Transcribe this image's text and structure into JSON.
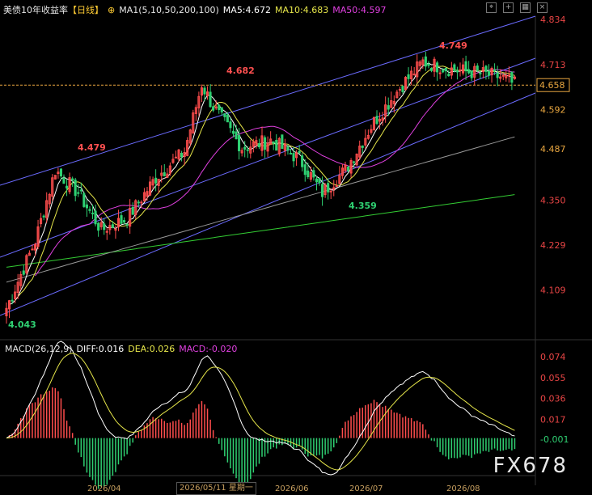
{
  "header": {
    "title": "美债10年收益率",
    "period": "【日线】",
    "ma_label": "MA1(5,10,50,200,100)",
    "ma5": "MA5:4.672",
    "ma10": "MA10:4.683",
    "ma50": "MA50:4.597",
    "colors": {
      "title": "#e6e6e6",
      "period": "#ffcc33",
      "ma5": "#ffffff",
      "ma10": "#e6e64a",
      "ma50": "#e040e0"
    }
  },
  "toolbar": {
    "icons": [
      "crosshair-icon",
      "add-icon",
      "grid-icon",
      "close-icon"
    ]
  },
  "macd_header": {
    "label": "MACD(26,12,9)",
    "diff": "DIFF:0.016",
    "dea": "DEA:0.026",
    "macd": "MACD:-0.020"
  },
  "watermark": "FX678",
  "crosshair_date": "2026/05/11 星期一",
  "chart_data": {
    "type": "candlestick",
    "main_axis_ticks": [
      "4.834",
      "4.713",
      "4.592",
      "4.487",
      "4.350",
      "4.229",
      "4.109"
    ],
    "current_price": "4.658",
    "annotations": [
      {
        "label": "4.749",
        "value": 4.749
      },
      {
        "label": "4.682",
        "value": 4.682
      },
      {
        "label": "4.479",
        "value": 4.479
      },
      {
        "label": "4.359",
        "value": 4.359
      },
      {
        "label": "4.043",
        "value": 4.043
      }
    ],
    "x_tick_labels": [
      "2026/04",
      "2026/05",
      "2026/06",
      "2026/07",
      "2026/08"
    ],
    "macd_axis_ticks": [
      "0.074",
      "0.055",
      "0.036",
      "0.017",
      "-0.001"
    ],
    "colors": {
      "up": "#ff4d4d",
      "down": "#2fd072",
      "ma5": "#ffffff",
      "ma10": "#e6e64a",
      "ma50": "#e040e0",
      "ma100": "#999999",
      "ma200": "#33cc33",
      "channel": "#6b6bff",
      "refline": "#e8a640"
    }
  }
}
